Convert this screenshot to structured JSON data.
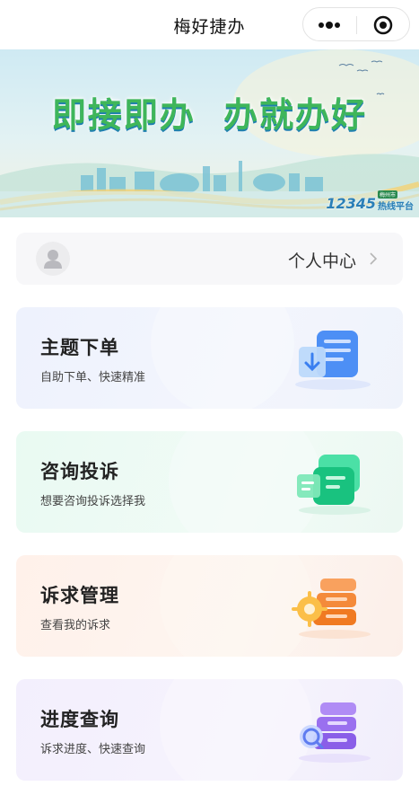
{
  "header": {
    "title": "梅好捷办",
    "more_icon": "more-dots-icon",
    "close_icon": "miniprogram-close-icon"
  },
  "banner": {
    "slogan_left": "即接即办",
    "slogan_right": "办就办好",
    "hotline_number": "12345",
    "hotline_badge": "梅州市",
    "hotline_text": "热线平台"
  },
  "profile": {
    "label": "个人中心",
    "avatar_icon": "user-avatar-icon",
    "chevron_icon": "chevron-right-icon"
  },
  "cards": [
    {
      "title": "主题下单",
      "subtitle": "自助下单、快速精准",
      "icon": "download-doc-icon",
      "accent": "#4a8af4"
    },
    {
      "title": "咨询投诉",
      "subtitle": "想要咨询投诉选择我",
      "icon": "chat-doc-icon",
      "accent": "#2ec98a"
    },
    {
      "title": "诉求管理",
      "subtitle": "查看我的诉求",
      "icon": "gear-stack-icon",
      "accent": "#f5923e"
    },
    {
      "title": "进度查询",
      "subtitle": "诉求进度、快速查询",
      "icon": "search-stack-icon",
      "accent": "#8a63e8"
    }
  ]
}
